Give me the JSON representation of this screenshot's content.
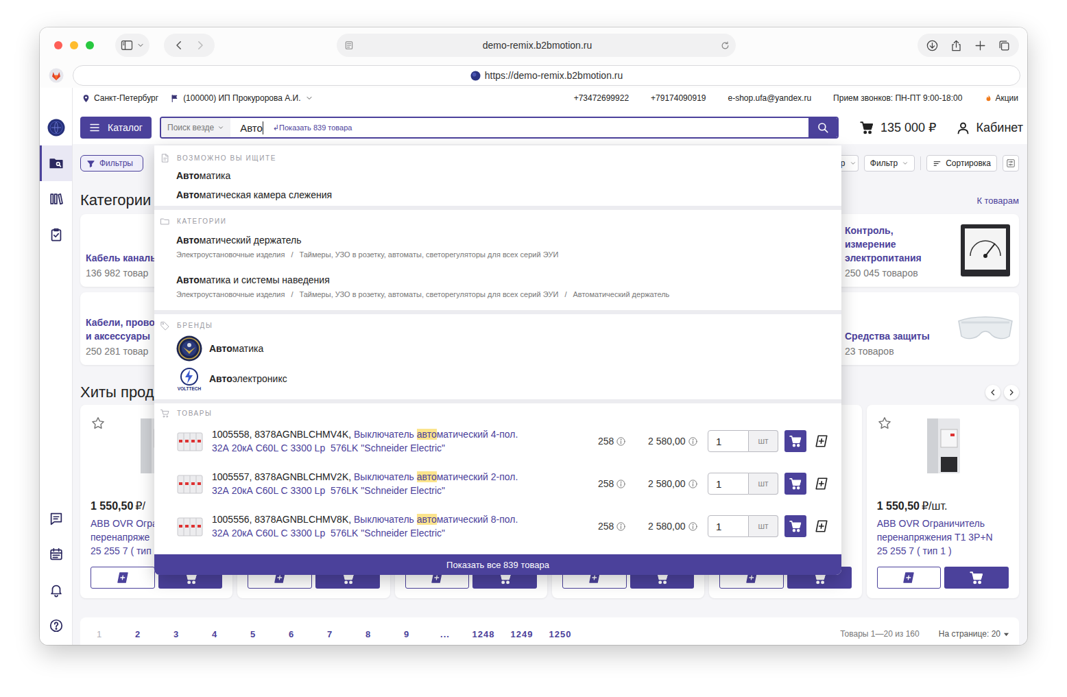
{
  "browser": {
    "address": "demo-remix.b2bmotion.ru",
    "url": "https://demo-remix.b2bmotion.ru"
  },
  "sidebar": {
    "top": [
      {
        "selected": false
      },
      {
        "selected": true
      },
      {
        "selected": false
      },
      {
        "selected": false
      }
    ],
    "bottom": [
      {
        "selected": false
      },
      {
        "selected": false
      },
      {
        "selected": false
      },
      {
        "selected": false
      }
    ]
  },
  "topbar": {
    "city": "Санкт-Петербург",
    "company": "(100000) ИП Прокуророва А.И.",
    "phones": [
      "+73472699922",
      "+79174090919"
    ],
    "email": "e-shop.ufa@yandex.ru",
    "hours": "Прием звонков: ПН-ПТ 9:00-18:00",
    "promo": "Акции"
  },
  "header": {
    "catalog": "Каталог",
    "search": {
      "scope": "Поиск везде",
      "value": "Авто",
      "hint": "↲Показать 839 товара"
    },
    "cart_total": "135 000 ₽",
    "cabinet": "Кабинет"
  },
  "toolbar": {
    "filters": "Фильтры",
    "select_tail": "р",
    "filter": "Фильтр",
    "sort": "Сортировка"
  },
  "categories": {
    "title": "Категории",
    "link": "К товарам",
    "left": [
      {
        "lines": [
          "Кабель каналь"
        ],
        "count": "136 982 товар"
      },
      {
        "lines": [
          "Кабели, провод",
          "и аксессуары"
        ],
        "count": "250 281 товар"
      }
    ],
    "right": [
      {
        "lines": [
          "Контроль,",
          "измерение",
          "электропитания"
        ],
        "count": "250 045 товаров"
      },
      {
        "lines": [
          "Средства защиты"
        ],
        "count": "23 товаров"
      }
    ]
  },
  "hits": {
    "title": "Хиты прод",
    "cards": [
      {
        "kind": "partial",
        "price": "1 550,50",
        "unit": "₽/",
        "lines": [
          "ABB OVR Огра",
          "перенапряже",
          "25 255 7 ( тип"
        ]
      },
      {
        "kind": "covered"
      },
      {
        "kind": "covered"
      },
      {
        "kind": "covered"
      },
      {
        "kind": "covered"
      },
      {
        "kind": "full",
        "price": "1 550,50",
        "unit": "₽/шт.",
        "lines": [
          "ABB OVR Ограничитель",
          "перенапряжения T1 3P+N",
          "25 255 7 ( тип 1 )"
        ]
      }
    ]
  },
  "pagination": {
    "pages": [
      {
        "label": "1",
        "selected": true
      },
      {
        "label": "2",
        "selected": false
      },
      {
        "label": "3",
        "selected": false
      },
      {
        "label": "4",
        "selected": false
      },
      {
        "label": "5",
        "selected": false
      },
      {
        "label": "6",
        "selected": false
      },
      {
        "label": "7",
        "selected": false
      },
      {
        "label": "8",
        "selected": false
      },
      {
        "label": "9",
        "selected": false
      },
      {
        "label": "...",
        "selected": false
      },
      {
        "label": "1248",
        "selected": false
      },
      {
        "label": "1249",
        "selected": false
      },
      {
        "label": "1250",
        "selected": false
      }
    ],
    "summary": "Товары 1—20 из 160",
    "per_page": "На странице: 20"
  },
  "dropdown": {
    "suggest": {
      "title": "ВОЗМОЖНО ВЫ ИЩИТЕ",
      "items": [
        {
          "match": "Авто",
          "rest": "матика"
        },
        {
          "match": "Авто",
          "rest": "матическая камера слежения"
        }
      ]
    },
    "categories": {
      "title": "КАТЕГОРИИ",
      "separator": "/",
      "items": [
        {
          "match": "Авто",
          "rest": "матический держатель",
          "path": [
            "Электроустановочные изделия",
            "Таймеры, УЗО в розетку, автоматы, светорегуляторы для всех серий ЭУИ"
          ]
        },
        {
          "match": "Авто",
          "rest": "матика и системы наведения",
          "path": [
            "Электроустановочные изделия",
            "Таймеры, УЗО в розетку, автоматы, светорегуляторы для всех серий ЭУИ",
            "Автоматический держатель"
          ]
        }
      ]
    },
    "brands": {
      "title": "БРЕНДЫ",
      "items": [
        {
          "kind": "emblem",
          "match": "Авто",
          "rest": "матика"
        },
        {
          "kind": "volttech",
          "logo_text": "VOLTTECH",
          "match": "Авто",
          "rest": "электроникс"
        }
      ]
    },
    "products": {
      "title": "ТОВАРЫ",
      "items": [
        {
          "code": "1005558, 8378AGNBLCHMV4K, ",
          "before": "Выключатель ",
          "match": "авто",
          "after": "матический 4-пол. 32А 20кА C60L C 3300 Lp  576LK \"Schneider Electric\"",
          "stock": "258",
          "price": "2 580,00",
          "qty": "1",
          "unit": "шт"
        },
        {
          "code": "1005557, 8378AGNBLCHMV2K, ",
          "before": "Выключатель ",
          "match": "авто",
          "after": "матический 2-пол. 32А 20кА C60L C 3300 Lp  576LK \"Schneider Electric\"",
          "stock": "258",
          "price": "2 580,00",
          "qty": "1",
          "unit": "шт"
        },
        {
          "code": "1005556, 8378AGNBLCHMV8K, ",
          "before": "Выключатель ",
          "match": "авто",
          "after": "матический 8-пол. 32А 20кА C60L C 3300 Lp  576LK \"Schneider Electric\"",
          "stock": "258",
          "price": "2 580,00",
          "qty": "1",
          "unit": "шт"
        }
      ]
    },
    "show_all": "Показать все 839 товара"
  }
}
